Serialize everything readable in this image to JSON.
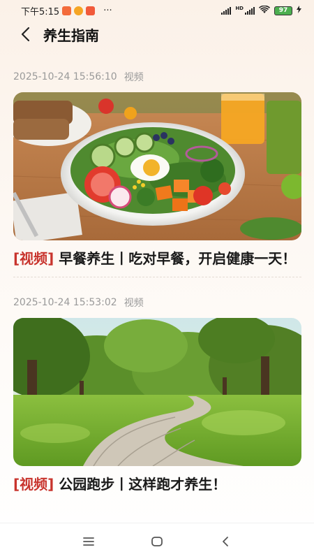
{
  "status_bar": {
    "time": "下午5:15",
    "more": "···",
    "battery": "97",
    "hd_label": "HD"
  },
  "header": {
    "title": "养生指南"
  },
  "articles": [
    {
      "timestamp": "2025-10-24 15:56:10",
      "type": "视频",
      "tag": "[视频]",
      "title": "早餐养生丨吃对早餐，开启健康一天！",
      "image": "breakfast-salad"
    },
    {
      "timestamp": "2025-10-24 15:53:02",
      "type": "视频",
      "tag": "[视频]",
      "title": "公园跑步丨这样跑才养生！",
      "image": "park-path"
    }
  ],
  "nav_bar": {
    "icons": [
      "menu-icon",
      "home-icon",
      "back-icon"
    ]
  },
  "colors": {
    "accent_red": "#c8342d",
    "meta_gray": "#9a9a9a",
    "battery_green": "#4caf50"
  }
}
